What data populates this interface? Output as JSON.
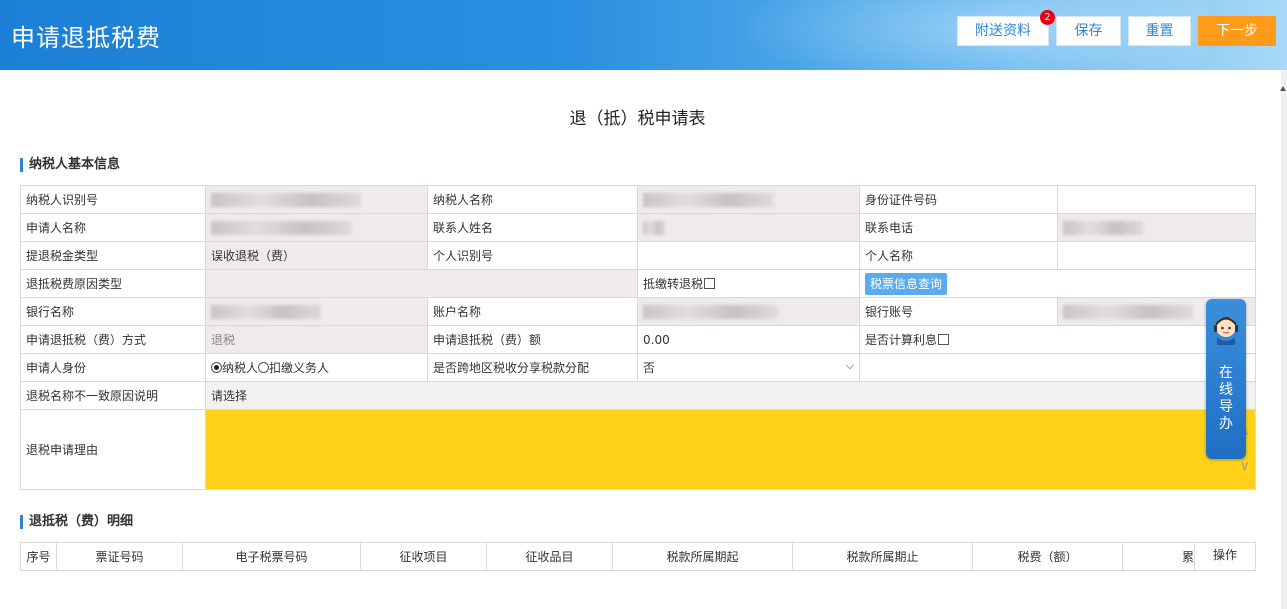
{
  "header": {
    "title": "申请退抵税费",
    "buttons": {
      "attach": "附送资料",
      "attach_badge": "2",
      "save": "保存",
      "reset": "重置",
      "next": "下一步"
    }
  },
  "form_title": "退（抵）税申请表",
  "section1": "纳税人基本信息",
  "info": {
    "taxpayer_id_label": "纳税人识别号",
    "taxpayer_name_label": "纳税人名称",
    "id_no_label": "身份证件号码",
    "applicant_label": "申请人名称",
    "contact_label": "联系人姓名",
    "phone_label": "联系电话",
    "tax_type_label": "提退税金类型",
    "tax_type_value": "误收退税（费）",
    "personal_id_label": "个人识别号",
    "personal_name_label": "个人名称",
    "reason_type_label": "退抵税费原因类型",
    "offset_label": "抵缴转退税",
    "query_button": "税票信息查询",
    "bank_name_label": "银行名称",
    "account_name_label": "账户名称",
    "bank_account_label": "银行账号",
    "method_label": "申请退抵税（费）方式",
    "method_value": "退税",
    "amount_label": "申请退抵税（费）额",
    "amount_value": "0.00",
    "interest_label": "是否计算利息",
    "identity_label": "申请人身份",
    "identity_opt1": "纳税人",
    "identity_opt2": "扣缴义务人",
    "cross_region_label": "是否跨地区税收分享税款分配",
    "cross_region_value": "否",
    "name_mismatch_label": "退税名称不一致原因说明",
    "name_mismatch_value": "请选择",
    "apply_reason_label": "退税申请理由"
  },
  "online_service": "在线导办",
  "section2": "退抵税（费）明细",
  "detail_columns": [
    "序号",
    "票证号码",
    "电子税票号码",
    "征收项目",
    "征收品目",
    "税款所属期起",
    "税款所属期止",
    "税费（额）",
    "累",
    "操作"
  ],
  "colors": {
    "header_blue": "#1b7fd6",
    "next_orange": "#ff9a1a",
    "reason_yellow": "#ffd11a",
    "accent_blue": "#2f86d9"
  }
}
